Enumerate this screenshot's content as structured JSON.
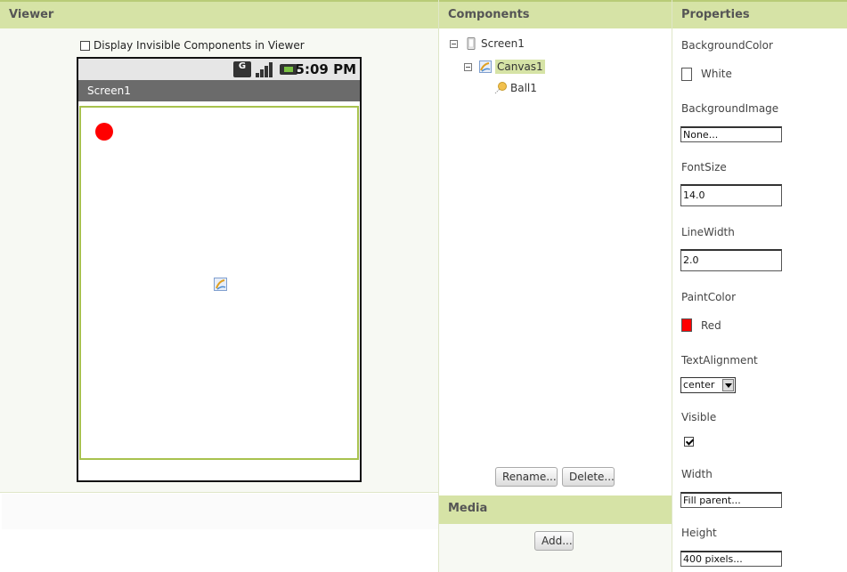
{
  "viewer": {
    "title": "Viewer",
    "display_invisible_label": "Display Invisible Components in Viewer",
    "display_invisible_checked": false,
    "phone": {
      "time": "5:09 PM",
      "screen_title": "Screen1",
      "status_g": "G"
    }
  },
  "components": {
    "title": "Components",
    "tree": [
      {
        "label": "Screen1",
        "icon": "screen-icon"
      },
      {
        "label": "Canvas1",
        "icon": "canvas-icon",
        "selected": true
      },
      {
        "label": "Ball1",
        "icon": "ball-icon"
      }
    ],
    "rename_label": "Rename...",
    "delete_label": "Delete..."
  },
  "media": {
    "title": "Media",
    "add_label": "Add..."
  },
  "properties": {
    "title": "Properties",
    "background_color": {
      "label": "BackgroundColor",
      "value": "White",
      "color": "#ffffff"
    },
    "background_image": {
      "label": "BackgroundImage",
      "value": "None..."
    },
    "font_size": {
      "label": "FontSize",
      "value": "14.0"
    },
    "line_width": {
      "label": "LineWidth",
      "value": "2.0"
    },
    "paint_color": {
      "label": "PaintColor",
      "value": "Red",
      "color": "#ff0000"
    },
    "text_alignment": {
      "label": "TextAlignment",
      "value": "center"
    },
    "visible": {
      "label": "Visible",
      "checked": true
    },
    "width": {
      "label": "Width",
      "value": "Fill parent..."
    },
    "height": {
      "label": "Height",
      "value": "400 pixels..."
    }
  },
  "colors": {
    "header_bg": "#d6e3a6",
    "ball": "#ff0000",
    "canvas_border": "#a8c24e"
  }
}
